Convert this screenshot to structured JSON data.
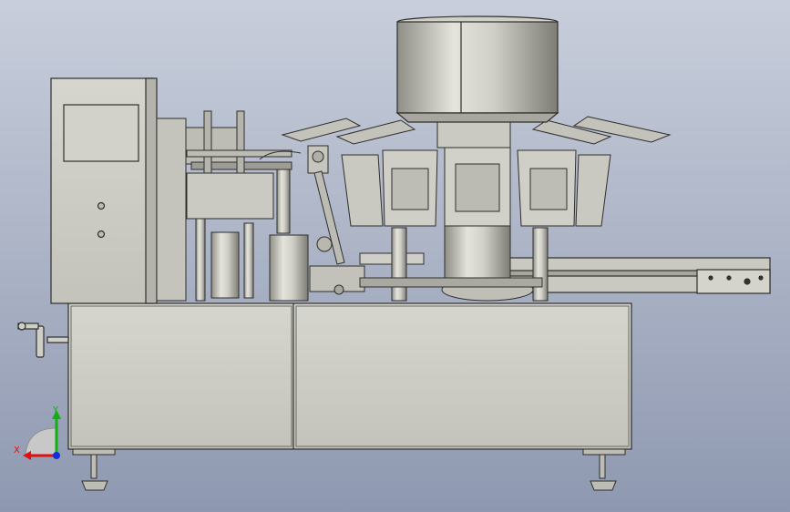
{
  "viewport": {
    "background_top": "#c8cedb",
    "background_bottom": "#8e98b0"
  },
  "model": {
    "metal_light": "#d8d8d0",
    "metal_mid": "#b9b9b0",
    "metal_dark": "#6e6e68",
    "outline": "#2e2e2c"
  },
  "triad": {
    "x_label": "X",
    "y_label": "Y",
    "x_color": "#e01010",
    "y_color": "#10b010",
    "z_color": "#1030e0"
  }
}
